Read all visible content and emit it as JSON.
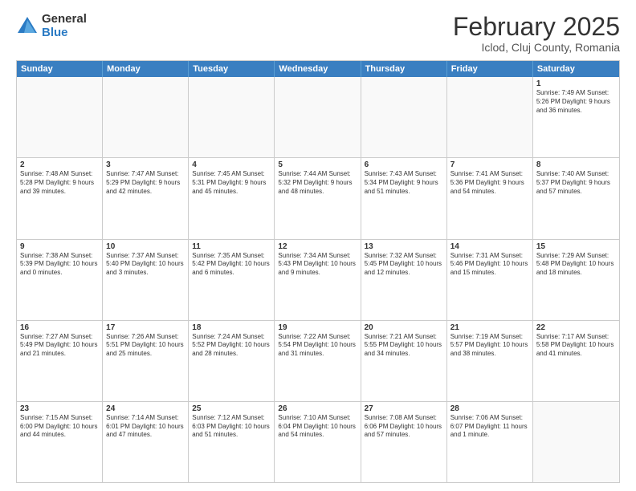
{
  "header": {
    "logo_general": "General",
    "logo_blue": "Blue",
    "main_title": "February 2025",
    "sub_title": "Iclod, Cluj County, Romania"
  },
  "calendar": {
    "days_of_week": [
      "Sunday",
      "Monday",
      "Tuesday",
      "Wednesday",
      "Thursday",
      "Friday",
      "Saturday"
    ],
    "rows": [
      [
        {
          "num": "",
          "info": "",
          "empty": true
        },
        {
          "num": "",
          "info": "",
          "empty": true
        },
        {
          "num": "",
          "info": "",
          "empty": true
        },
        {
          "num": "",
          "info": "",
          "empty": true
        },
        {
          "num": "",
          "info": "",
          "empty": true
        },
        {
          "num": "",
          "info": "",
          "empty": true
        },
        {
          "num": "1",
          "info": "Sunrise: 7:49 AM\nSunset: 5:26 PM\nDaylight: 9 hours and 36 minutes.",
          "empty": false
        }
      ],
      [
        {
          "num": "2",
          "info": "Sunrise: 7:48 AM\nSunset: 5:28 PM\nDaylight: 9 hours and 39 minutes.",
          "empty": false
        },
        {
          "num": "3",
          "info": "Sunrise: 7:47 AM\nSunset: 5:29 PM\nDaylight: 9 hours and 42 minutes.",
          "empty": false
        },
        {
          "num": "4",
          "info": "Sunrise: 7:45 AM\nSunset: 5:31 PM\nDaylight: 9 hours and 45 minutes.",
          "empty": false
        },
        {
          "num": "5",
          "info": "Sunrise: 7:44 AM\nSunset: 5:32 PM\nDaylight: 9 hours and 48 minutes.",
          "empty": false
        },
        {
          "num": "6",
          "info": "Sunrise: 7:43 AM\nSunset: 5:34 PM\nDaylight: 9 hours and 51 minutes.",
          "empty": false
        },
        {
          "num": "7",
          "info": "Sunrise: 7:41 AM\nSunset: 5:36 PM\nDaylight: 9 hours and 54 minutes.",
          "empty": false
        },
        {
          "num": "8",
          "info": "Sunrise: 7:40 AM\nSunset: 5:37 PM\nDaylight: 9 hours and 57 minutes.",
          "empty": false
        }
      ],
      [
        {
          "num": "9",
          "info": "Sunrise: 7:38 AM\nSunset: 5:39 PM\nDaylight: 10 hours and 0 minutes.",
          "empty": false
        },
        {
          "num": "10",
          "info": "Sunrise: 7:37 AM\nSunset: 5:40 PM\nDaylight: 10 hours and 3 minutes.",
          "empty": false
        },
        {
          "num": "11",
          "info": "Sunrise: 7:35 AM\nSunset: 5:42 PM\nDaylight: 10 hours and 6 minutes.",
          "empty": false
        },
        {
          "num": "12",
          "info": "Sunrise: 7:34 AM\nSunset: 5:43 PM\nDaylight: 10 hours and 9 minutes.",
          "empty": false
        },
        {
          "num": "13",
          "info": "Sunrise: 7:32 AM\nSunset: 5:45 PM\nDaylight: 10 hours and 12 minutes.",
          "empty": false
        },
        {
          "num": "14",
          "info": "Sunrise: 7:31 AM\nSunset: 5:46 PM\nDaylight: 10 hours and 15 minutes.",
          "empty": false
        },
        {
          "num": "15",
          "info": "Sunrise: 7:29 AM\nSunset: 5:48 PM\nDaylight: 10 hours and 18 minutes.",
          "empty": false
        }
      ],
      [
        {
          "num": "16",
          "info": "Sunrise: 7:27 AM\nSunset: 5:49 PM\nDaylight: 10 hours and 21 minutes.",
          "empty": false
        },
        {
          "num": "17",
          "info": "Sunrise: 7:26 AM\nSunset: 5:51 PM\nDaylight: 10 hours and 25 minutes.",
          "empty": false
        },
        {
          "num": "18",
          "info": "Sunrise: 7:24 AM\nSunset: 5:52 PM\nDaylight: 10 hours and 28 minutes.",
          "empty": false
        },
        {
          "num": "19",
          "info": "Sunrise: 7:22 AM\nSunset: 5:54 PM\nDaylight: 10 hours and 31 minutes.",
          "empty": false
        },
        {
          "num": "20",
          "info": "Sunrise: 7:21 AM\nSunset: 5:55 PM\nDaylight: 10 hours and 34 minutes.",
          "empty": false
        },
        {
          "num": "21",
          "info": "Sunrise: 7:19 AM\nSunset: 5:57 PM\nDaylight: 10 hours and 38 minutes.",
          "empty": false
        },
        {
          "num": "22",
          "info": "Sunrise: 7:17 AM\nSunset: 5:58 PM\nDaylight: 10 hours and 41 minutes.",
          "empty": false
        }
      ],
      [
        {
          "num": "23",
          "info": "Sunrise: 7:15 AM\nSunset: 6:00 PM\nDaylight: 10 hours and 44 minutes.",
          "empty": false
        },
        {
          "num": "24",
          "info": "Sunrise: 7:14 AM\nSunset: 6:01 PM\nDaylight: 10 hours and 47 minutes.",
          "empty": false
        },
        {
          "num": "25",
          "info": "Sunrise: 7:12 AM\nSunset: 6:03 PM\nDaylight: 10 hours and 51 minutes.",
          "empty": false
        },
        {
          "num": "26",
          "info": "Sunrise: 7:10 AM\nSunset: 6:04 PM\nDaylight: 10 hours and 54 minutes.",
          "empty": false
        },
        {
          "num": "27",
          "info": "Sunrise: 7:08 AM\nSunset: 6:06 PM\nDaylight: 10 hours and 57 minutes.",
          "empty": false
        },
        {
          "num": "28",
          "info": "Sunrise: 7:06 AM\nSunset: 6:07 PM\nDaylight: 11 hours and 1 minute.",
          "empty": false
        },
        {
          "num": "",
          "info": "",
          "empty": true
        }
      ]
    ]
  }
}
